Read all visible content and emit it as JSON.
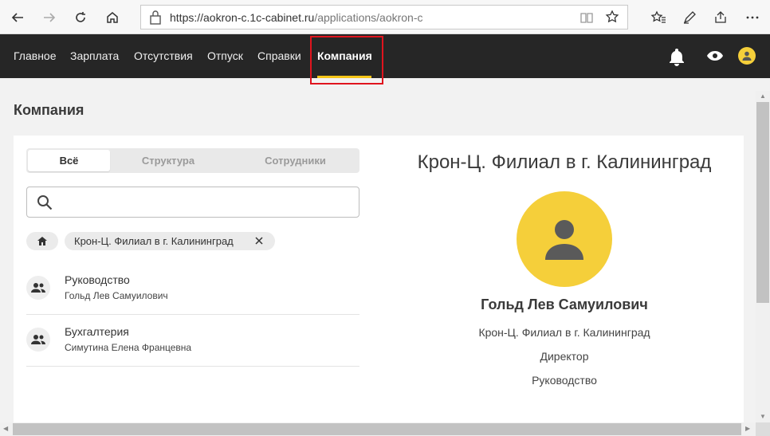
{
  "browser": {
    "url_main": "https://aokron-c.1c-cabinet.ru",
    "url_path": "/applications/aokron-c"
  },
  "topnav": {
    "items": [
      "Главное",
      "Зарплата",
      "Отсутствия",
      "Отпуск",
      "Справки",
      "Компания"
    ],
    "active_index": 5,
    "accent_color": "#f5c518"
  },
  "page": {
    "title": "Компания"
  },
  "tabs": [
    "Всё",
    "Структура",
    "Сотрудники"
  ],
  "search": {
    "placeholder": "",
    "value": ""
  },
  "breadcrumb": {
    "chip_label": "Крон-Ц. Филиал в г. Калининград"
  },
  "departments": [
    {
      "name": "Руководство",
      "head": "Гольд Лев Самуилович"
    },
    {
      "name": "Бухгалтерия",
      "head": "Симутина Елена Францевна"
    }
  ],
  "details": {
    "org_title": "Крон-Ц. Филиал в г. Калининград",
    "person_name": "Гольд Лев Самуилович",
    "organization": "Крон-Ц. Филиал в г. Калининград",
    "position": "Директор",
    "department": "Руководство"
  },
  "icons": {
    "back": "arrow-left-icon",
    "forward": "arrow-right-icon",
    "refresh": "refresh-icon",
    "home": "home-icon",
    "lock": "lock-icon",
    "reading": "reading-view-icon",
    "favorite": "star-icon",
    "favorites": "favorites-icon",
    "pen": "pen-icon",
    "share": "share-icon",
    "more": "more-icon",
    "bell": "bell-icon",
    "eye": "eye-icon",
    "avatar": "avatar-icon",
    "search": "search-icon",
    "close": "close-icon",
    "people": "people-icon"
  }
}
